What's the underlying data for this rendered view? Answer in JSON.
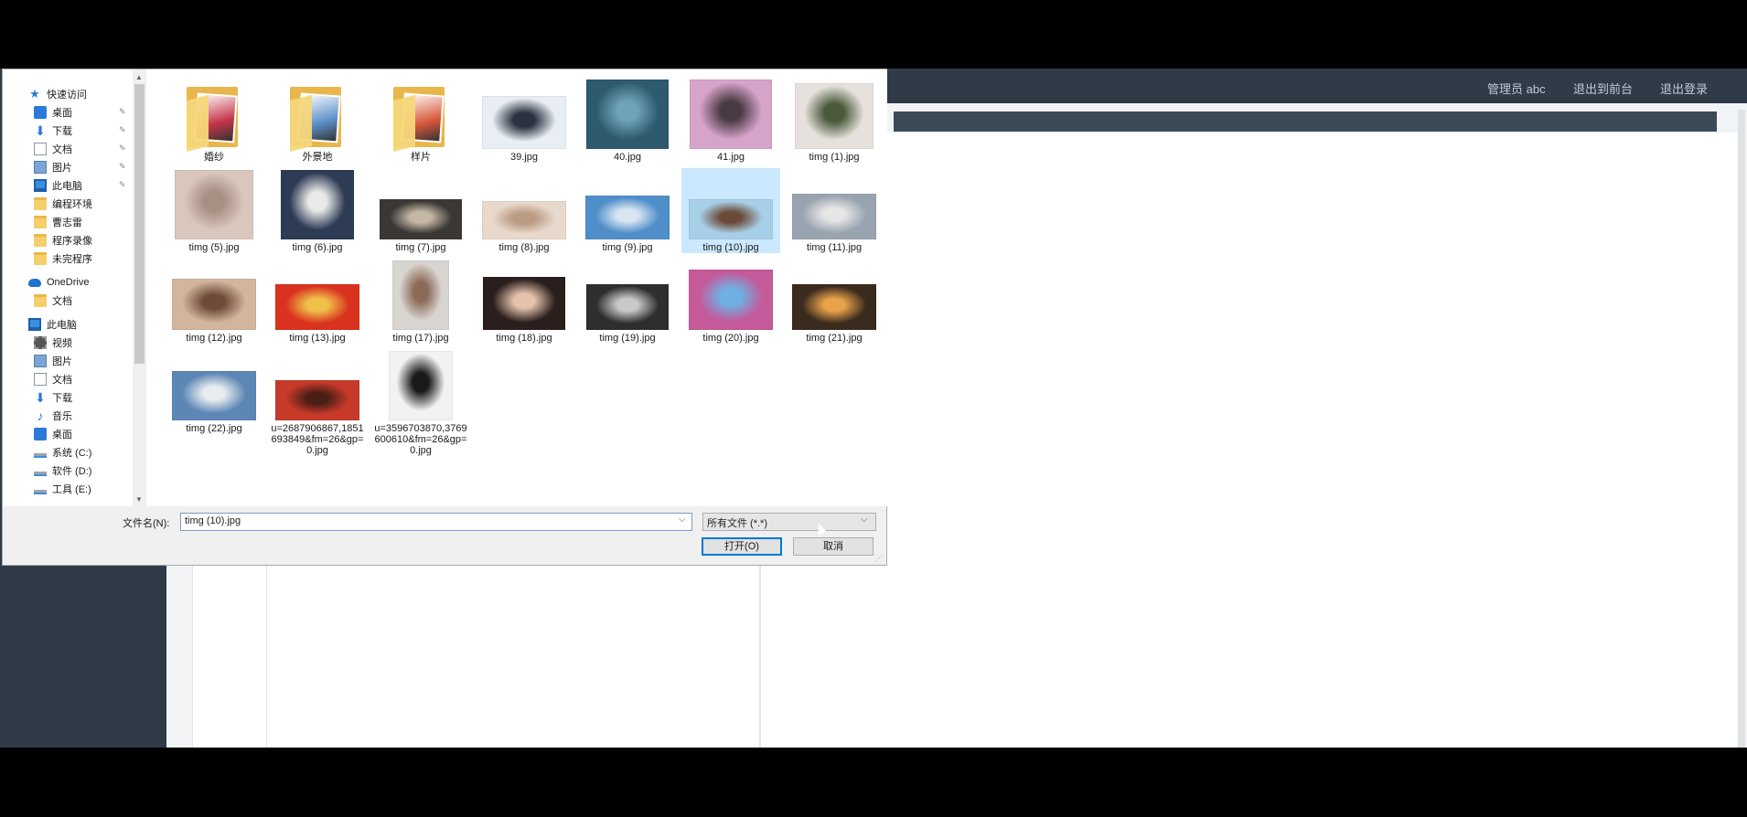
{
  "app": {
    "user_label": "管理员 abc",
    "back_label": "退出到前台",
    "logout_label": "退出登录"
  },
  "dialog": {
    "nav": {
      "quick_access": "快速访问",
      "items": [
        {
          "label": "桌面",
          "icon": "desktop-icon",
          "pinned": true
        },
        {
          "label": "下载",
          "icon": "download-icon",
          "pinned": true
        },
        {
          "label": "文档",
          "icon": "document-icon",
          "pinned": true
        },
        {
          "label": "图片",
          "icon": "picture-icon",
          "pinned": true
        },
        {
          "label": "此电脑",
          "icon": "computer-icon",
          "pinned": true
        },
        {
          "label": "编程环境",
          "icon": "folder-icon",
          "pinned": false
        },
        {
          "label": "曹志雷",
          "icon": "folder-icon",
          "pinned": false
        },
        {
          "label": "程序录像",
          "icon": "folder-icon",
          "pinned": false
        },
        {
          "label": "未完程序",
          "icon": "folder-icon",
          "pinned": false
        }
      ],
      "onedrive": "OneDrive",
      "onedrive_items": [
        {
          "label": "文档",
          "icon": "folder-icon"
        }
      ],
      "this_pc": "此电脑",
      "pc_items": [
        {
          "label": "视频",
          "icon": "video-icon"
        },
        {
          "label": "图片",
          "icon": "picture-icon"
        },
        {
          "label": "文档",
          "icon": "document-icon"
        },
        {
          "label": "下载",
          "icon": "download-icon"
        },
        {
          "label": "音乐",
          "icon": "music-icon"
        },
        {
          "label": "桌面",
          "icon": "desktop-icon"
        },
        {
          "label": "系统 (C:)",
          "icon": "drive-icon"
        },
        {
          "label": "软件 (D:)",
          "icon": "drive-icon"
        },
        {
          "label": "工具 (E:)",
          "icon": "drive-icon"
        }
      ]
    },
    "files": [
      {
        "name": "婚纱",
        "type": "folder",
        "color": "#c4344a"
      },
      {
        "name": "外景地",
        "type": "folder",
        "color": "#5b8fc9"
      },
      {
        "name": "样片",
        "type": "folder",
        "color": "#d9573b"
      },
      {
        "name": "39.jpg",
        "type": "image",
        "color": "#e8eef4",
        "accent": "#2a3240"
      },
      {
        "name": "40.jpg",
        "type": "image",
        "color": "#2d5a6e",
        "accent": "#6fa3b8"
      },
      {
        "name": "41.jpg",
        "type": "image",
        "color": "#d6a3c9",
        "accent": "#4a3a44"
      },
      {
        "name": "timg (1).jpg",
        "type": "image",
        "color": "#e6e1dc",
        "accent": "#4a5a3a"
      },
      {
        "name": "timg (5).jpg",
        "type": "image",
        "color": "#d9c6bd",
        "accent": "#a88f84"
      },
      {
        "name": "timg (6).jpg",
        "type": "image",
        "color": "#2e3b55",
        "accent": "#e9e9e9"
      },
      {
        "name": "timg (7).jpg",
        "type": "image",
        "color": "#3a3734",
        "accent": "#c6b8a6"
      },
      {
        "name": "timg (8).jpg",
        "type": "image",
        "color": "#e8d9cc",
        "accent": "#b99a82"
      },
      {
        "name": "timg (9).jpg",
        "type": "image",
        "color": "#4f8ec9",
        "accent": "#d9e6f2"
      },
      {
        "name": "timg (10).jpg",
        "type": "image",
        "color": "#a8cfe8",
        "accent": "#6b4a38",
        "selected": true
      },
      {
        "name": "timg (11).jpg",
        "type": "image",
        "color": "#9aa4b0",
        "accent": "#e6e6e6"
      },
      {
        "name": "timg (12).jpg",
        "type": "image",
        "color": "#d2b59d",
        "accent": "#6e4a38"
      },
      {
        "name": "timg (13).jpg",
        "type": "image",
        "color": "#d9321f",
        "accent": "#f0c04a"
      },
      {
        "name": "timg (17).jpg",
        "type": "image",
        "color": "#d8d4d0",
        "accent": "#8b6a58"
      },
      {
        "name": "timg (18).jpg",
        "type": "image",
        "color": "#2a1f1c",
        "accent": "#e4c2ad"
      },
      {
        "name": "timg (19).jpg",
        "type": "image",
        "color": "#2e2e2e",
        "accent": "#c9c9c9"
      },
      {
        "name": "timg (20).jpg",
        "type": "image",
        "color": "#c45a9a",
        "accent": "#6fb0e3"
      },
      {
        "name": "timg (21).jpg",
        "type": "image",
        "color": "#3b2a1e",
        "accent": "#e8a24a"
      },
      {
        "name": "timg (22).jpg",
        "type": "image",
        "color": "#5c87b5",
        "accent": "#e9ecef"
      },
      {
        "name": "u=2687906867,1851693849&fm=26&gp=0.jpg",
        "type": "image",
        "color": "#c73a2a",
        "accent": "#4a1e15"
      },
      {
        "name": "u=3596703870,3769600610&fm=26&gp=0.jpg",
        "type": "image",
        "color": "#f2f2f2",
        "accent": "#1a1a1a"
      }
    ],
    "filename_label": "文件名(N):",
    "filename_value": "timg (10).jpg",
    "filetype_value": "所有文件 (*.*)",
    "open_label": "打开(O)",
    "cancel_label": "取消"
  }
}
